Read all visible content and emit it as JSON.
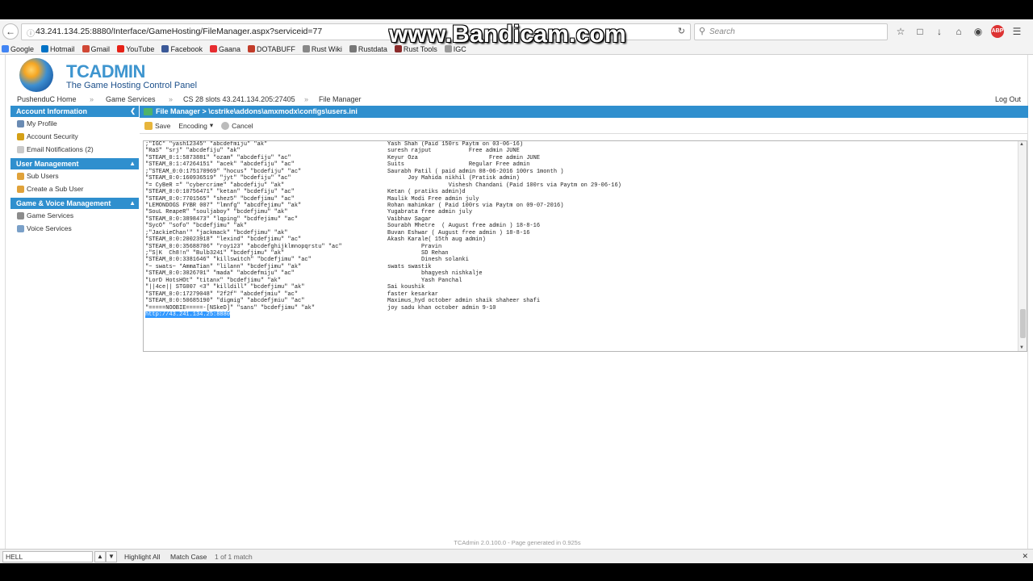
{
  "browser": {
    "url_host": "43.241.134.25:8880/Interface/GameHosting/FileManager.aspx?serviceid=77",
    "search_placeholder": "Search",
    "bookmarks": [
      {
        "label": "Google",
        "color": "#4285f4"
      },
      {
        "label": "Hotmail",
        "color": "#0072c6"
      },
      {
        "label": "Gmail",
        "color": "#d14836"
      },
      {
        "label": "YouTube",
        "color": "#e62117"
      },
      {
        "label": "Facebook",
        "color": "#3b5998"
      },
      {
        "label": "Gaana",
        "color": "#e72c30"
      },
      {
        "label": "DOTABUFF",
        "color": "#c23c2a"
      },
      {
        "label": "Rust Wiki",
        "color": "#888888"
      },
      {
        "label": "Rustdata",
        "color": "#777777"
      },
      {
        "label": "Rust Tools",
        "color": "#8b2b2b"
      },
      {
        "label": "IGC",
        "color": "#999999"
      }
    ],
    "abp_label": "ABP"
  },
  "watermark": "www.Bandicam.com",
  "app": {
    "logo_name": "TCADMIN",
    "logo_sub": "The Game Hosting Control Panel",
    "breadcrumb": [
      "PushenduC Home",
      "Game Services",
      "CS 28 slots 43.241.134.205:27405",
      "File Manager"
    ],
    "logout": "Log Out"
  },
  "sidebar": {
    "sections": [
      {
        "title": "Account Information",
        "items": [
          "My Profile",
          "Account Security",
          "Email Notifications (2)"
        ]
      },
      {
        "title": "User Management",
        "items": [
          "Sub Users",
          "Create a Sub User"
        ]
      },
      {
        "title": "Game & Voice Management",
        "items": [
          "Game Services",
          "Voice Services"
        ]
      }
    ]
  },
  "main": {
    "title": "File Manager > \\cstrike\\addons\\amxmodx\\configs\\users.ini",
    "toolbar": {
      "save": "Save",
      "encoding": "Encoding",
      "cancel": "Cancel"
    },
    "lines": [
      {
        "l": ";\"IGC\" \"yash12345\" \"abcdefmiju\" \"ak\"",
        "r": "Yash Shah (Paid 150rs Paytm on 03-06-16)"
      },
      {
        "l": "\"RaS\" \"srj\" \"abcdefiju\" \"ak\"",
        "r": "suresh rajput           Free admin JUNE"
      },
      {
        "l": "\"STEAM_0:1:5873881\" \"ozam\" \"abcdefiju\" \"ac\"",
        "r": "Keyur Oza                     Free admin JUNE"
      },
      {
        "l": "\"STEAM_0:1:47264151\" \"acek\" \"abcdefiju\" \"ac\"",
        "r": "Suits                   Regular Free admin"
      },
      {
        "l": ";\"STEAM_0:0:175170969\" \"hocus\" \"bcdefiju\" \"ac\"",
        "r": "Saurabh Patil ( paid admin 08-06-2016 100rs 1month )"
      },
      {
        "l": "\"STEAM_0:0:160936519\" \"jyt\" \"bcdefiju\" \"ac\"",
        "r": "      Joy Mahida nikhil (Pratisk admin)"
      },
      {
        "l": "\"= CyBeR =\" \"cybercrime\" \"abcdefiju\" \"ak\"",
        "r": "                  Vishesh Chandani (Paid 100rs via Paytm on 29-06-16)"
      },
      {
        "l": "\"STEAM_0:0:10756471\" \"ketan\" \"bcdefiju\" \"ac\"",
        "r": "Ketan ( pratiks admin)d"
      },
      {
        "l": "\"STEAM_0:0:7701565\" \"shez5\" \"bcdefjimu\" \"ac\"",
        "r": "Maulik Modi Free admin july"
      },
      {
        "l": "\"LEMONDOGS FYBR 007\" \"lmnfg\" \"abcdfejimu\" \"ak\"",
        "r": "Rohan mahimkar ( Paid 100rs via Paytm on 09-07-2016)"
      },
      {
        "l": "\"SouL ReapeR\" \"souljaboy\" \"bcdefjimu\" \"ak\"",
        "r": "Yugabrata free admin july"
      },
      {
        "l": "\"STEAM_0:0:3898473\" \"lqping\" \"bcdfejimu\" \"ac\"",
        "r": "Vaibhav Sagar"
      },
      {
        "l": "\"SycO\" \"sofo\" \"bcdefjimu\" \"ak\"",
        "r": "Sourabh Mhetre  ( August free admin ) 18-8-16"
      },
      {
        "l": ";\"JackieChan'\" \"jackmack\" \"bcdefjimu\" \"ak\"",
        "r": "Buvan Eshwar ( August free admin ) 18-8-16"
      },
      {
        "l": "\"STEAM_0:0:20023918\" \"lexind\" \"bcdefjimu\" \"ac\"",
        "r": "Akash Karale( 15th aug admin)"
      },
      {
        "l": "\"STEAM_0:0:35688706\" \"roy123\" \"abcdefghijklmnopqrstu\" \"ac\"",
        "r": "          Pravin"
      },
      {
        "l": ";\"S|K  Ch8!n\" \"Bulb3241\" \"bcdefjimu\" \"ak\"",
        "r": "          SD Rehan"
      },
      {
        "l": "\"STEAM_0:0:3381646\" \"killswitch\" \"bcdefjimu\" \"ac\"",
        "r": "          Dinesh solanki"
      },
      {
        "l": "\"~ swats~ *AmmaTian\" \"lilann\" \"bcdefjimu\" \"ak\"",
        "r": "swats swastik"
      },
      {
        "l": "\"STEAM_0:0:3026701\" \"mada\" \"abcdefmiju\" \"ac\"",
        "r": "          bhagyesh nishkalje"
      },
      {
        "l": "\"LorD HotsHOt\" \"titanx\" \"bcdefjimu\" \"ak\"",
        "r": "          Yash Panchal"
      },
      {
        "l": "\"||4ce|| STG007 <3\" \"killdill\" \"bcdefjimu\" \"ak\"",
        "r": "Sai koushik"
      },
      {
        "l": "\"STEAM_0:0:17279048\" \"2f2f\" \"abcdefjmiu\" \"ac\"",
        "r": "faster kesarkar"
      },
      {
        "l": "\"STEAM_0:0:50685190\" \"digmig\" \"abcdefjmiu\" \"ac\"",
        "r": "Maximus_hyd october admin shaik shaheer shafi"
      },
      {
        "l": "\"=====NOOBIE=====-[NSkeD]\" \"sans\" \"bcdefjimu\" \"ak\"",
        "r": "joy sadu khan october admin 9-10"
      }
    ],
    "selected_line": "http://43.241.134.25:8880"
  },
  "footer": "TCAdmin 2.0.100.0 - Page generated in 0.925s",
  "findbar": {
    "query": "HELL",
    "highlight_all": "Highlight All",
    "match_case": "Match Case",
    "result": "1 of 1 match"
  }
}
